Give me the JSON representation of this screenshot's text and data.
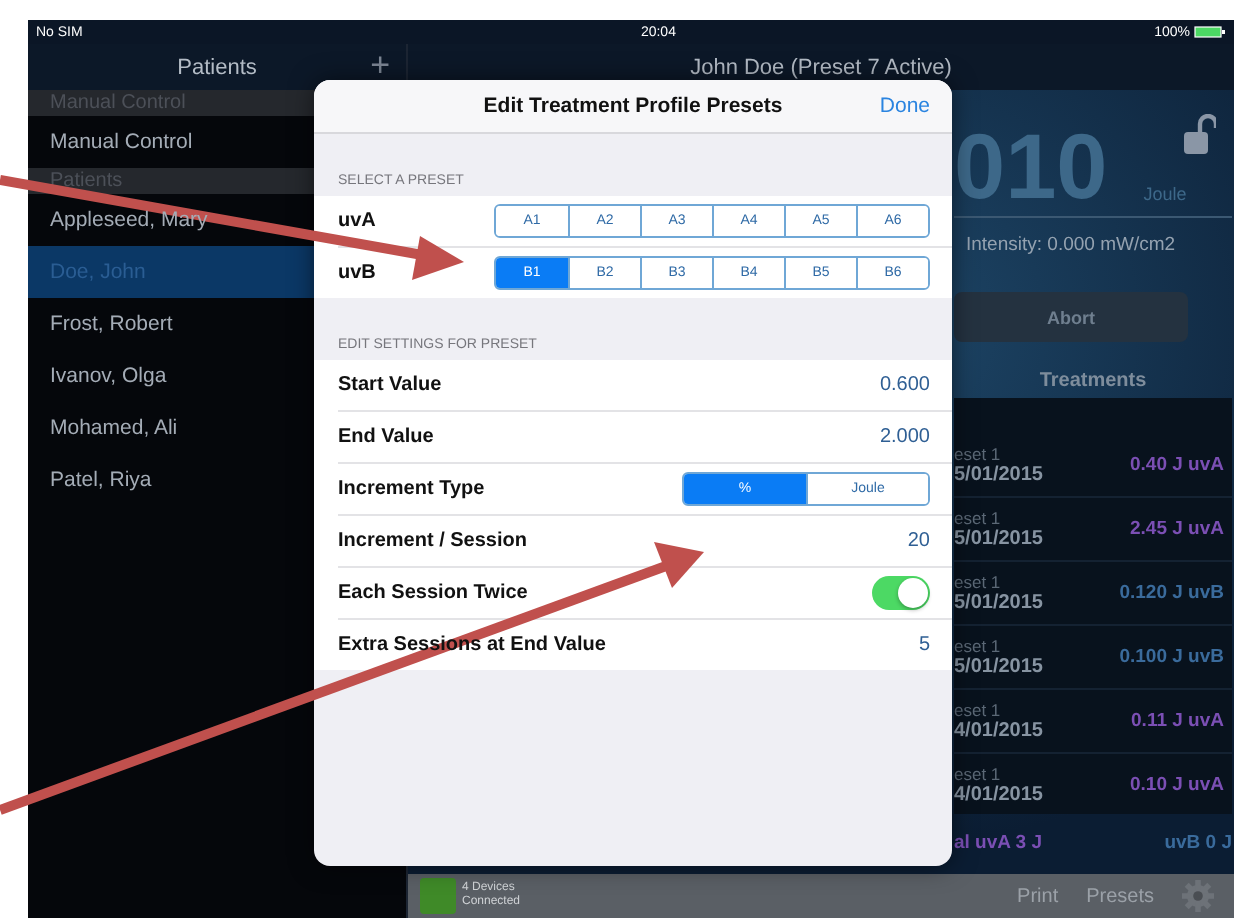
{
  "status_bar": {
    "carrier": "No SIM",
    "time": "20:04",
    "battery": "100%"
  },
  "sidebar": {
    "title": "Patients",
    "add_button": "+",
    "sections": [
      {
        "header": "Manual Control",
        "items": [
          {
            "label": "Manual Control",
            "selected": false
          }
        ]
      },
      {
        "header": "Patients",
        "items": [
          {
            "label": "Appleseed, Mary",
            "selected": false
          },
          {
            "label": "Doe, John",
            "selected": true
          },
          {
            "label": "Frost, Robert",
            "selected": false
          },
          {
            "label": "Ivanov, Olga",
            "selected": false
          },
          {
            "label": "Mohamed, Ali",
            "selected": false
          },
          {
            "label": "Patel, Riya",
            "selected": false
          }
        ]
      }
    ]
  },
  "main": {
    "title": "John Doe (Preset 7 Active)",
    "reading": "010",
    "unit": "Joule",
    "intensity": "Intensity: 0.000 mW/cm2",
    "abort_button": "Abort",
    "treatments": {
      "title": "Treatments",
      "rows": [
        {
          "line_1": "eset 1",
          "line_2": "5/01/2015",
          "dose": "0.40 J uvA",
          "color": "#7b4fb4"
        },
        {
          "line_1": "eset 1",
          "line_2": "5/01/2015",
          "dose": "2.45 J uvA",
          "color": "#7b4fb4"
        },
        {
          "line_1": "eset 1",
          "line_2": "5/01/2015",
          "dose": "0.120 J uvB",
          "color": "#3a6b9c"
        },
        {
          "line_1": "eset 1",
          "line_2": "5/01/2015",
          "dose": "0.100 J uvB",
          "color": "#3a6b9c"
        },
        {
          "line_1": "eset 1",
          "line_2": "4/01/2015",
          "dose": "0.11 J uvA",
          "color": "#7b4fb4"
        },
        {
          "line_1": "eset 1",
          "line_2": "4/01/2015",
          "dose": "0.10 J uvA",
          "color": "#7b4fb4"
        }
      ]
    },
    "totals": [
      {
        "text": "al uvA 3 J",
        "color": "#7b4fb4"
      },
      {
        "text": "uvB 0 J",
        "color": "#3a6b9c"
      }
    ]
  },
  "toolbar": {
    "devices": "4 Devices Connected",
    "buttons": [
      "Print",
      "Presets"
    ]
  },
  "modal": {
    "title": "Edit Treatment Profile Presets",
    "done_button": "Done",
    "preset_section": {
      "header": "SELECT A PRESET",
      "rows": [
        {
          "label": "uvA",
          "options": [
            {
              "label": "A1",
              "selected": false
            },
            {
              "label": "A2",
              "selected": false
            },
            {
              "label": "A3",
              "selected": false
            },
            {
              "label": "A4",
              "selected": false
            },
            {
              "label": "A5",
              "selected": false
            },
            {
              "label": "A6",
              "selected": false
            }
          ]
        },
        {
          "label": "uvB",
          "options": [
            {
              "label": "B1",
              "selected": true
            },
            {
              "label": "B2",
              "selected": false
            },
            {
              "label": "B3",
              "selected": false
            },
            {
              "label": "B4",
              "selected": false
            },
            {
              "label": "B5",
              "selected": false
            },
            {
              "label": "B6",
              "selected": false
            }
          ]
        }
      ]
    },
    "settings_section": {
      "header": "EDIT SETTINGS FOR PRESET",
      "rows": [
        {
          "kind": "value",
          "label": "Start Value",
          "value": "0.600"
        },
        {
          "kind": "value",
          "label": "End Value",
          "value": "2.000"
        },
        {
          "kind": "segmented",
          "label": "Increment Type",
          "options": [
            {
              "label": "%",
              "selected": true
            },
            {
              "label": "Joule",
              "selected": false
            }
          ]
        },
        {
          "kind": "value",
          "label": "Increment / Session",
          "value": "20"
        },
        {
          "kind": "toggle",
          "label": "Each Session Twice",
          "on": true
        },
        {
          "kind": "value",
          "label": "Extra Sessions at End Value",
          "value": "5"
        }
      ]
    }
  }
}
